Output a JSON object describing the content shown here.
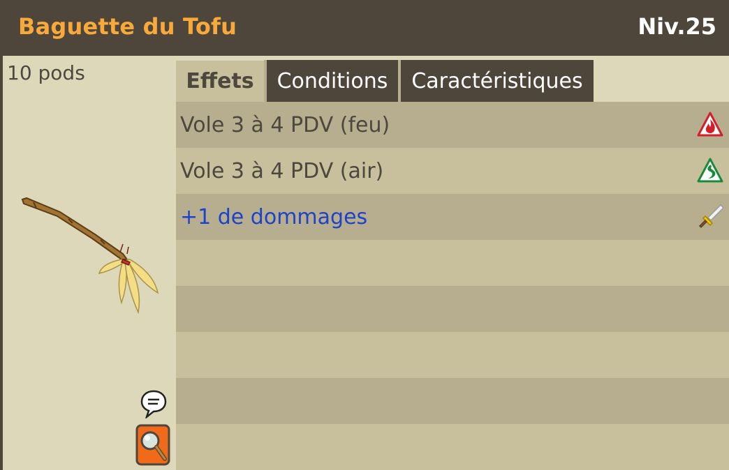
{
  "item": {
    "name": "Baguette du Tofu",
    "level": "Niv.25",
    "weight": "10 pods"
  },
  "tabs": [
    {
      "label": "Effets",
      "active": true
    },
    {
      "label": "Conditions",
      "active": false
    },
    {
      "label": "Caractéristiques",
      "active": false
    }
  ],
  "effects": [
    {
      "text": "Vole 3 à 4 PDV (feu)",
      "icon": "fire-element-icon",
      "color": "#4d473d"
    },
    {
      "text": "Vole 3 à 4 PDV (air)",
      "icon": "air-element-icon",
      "color": "#4d473d"
    },
    {
      "text": "+1 de dommages",
      "icon": "sword-damage-icon",
      "color": "#1f43c8"
    }
  ],
  "colors": {
    "header_bg": "#4f463b",
    "title": "#f7a93b",
    "panel_bg": "#dcd8b9",
    "row_dark": "#b6ae8f",
    "row_light": "#c8c09c",
    "bonus_text": "#1f43c8"
  }
}
